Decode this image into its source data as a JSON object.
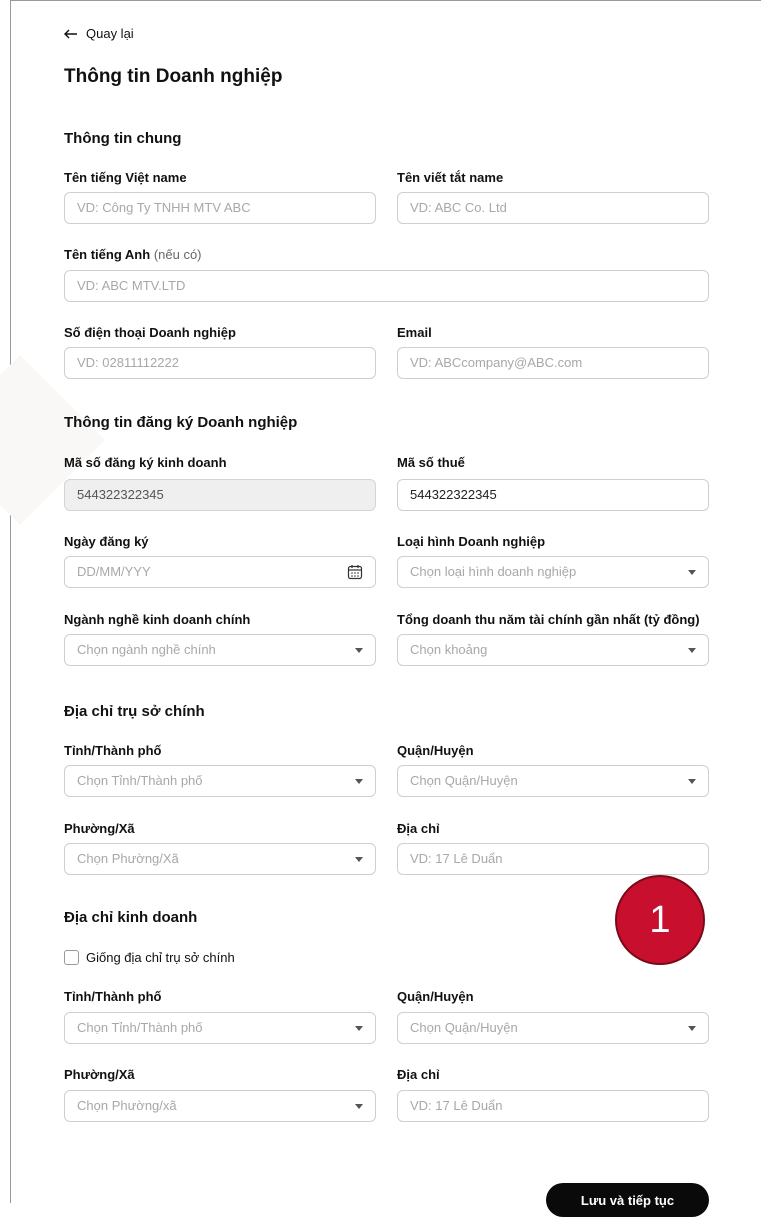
{
  "back": {
    "label": "Quay lại"
  },
  "page_title": "Thông tin Doanh nghiệp",
  "sections": {
    "general": "Thông tin chung",
    "registration": "Thông tin đăng ký Doanh nghiệp",
    "head_office": "Địa chỉ trụ sở chính",
    "business_address": "Địa chỉ kinh doanh"
  },
  "fields": {
    "vn_name": {
      "label": "Tên tiếng Việt name",
      "placeholder": "VD: Công Ty TNHH MTV ABC"
    },
    "short_name": {
      "label": "Tên viết tắt name",
      "placeholder": "VD: ABC Co. Ltd"
    },
    "en_name": {
      "label": "Tên tiếng Anh",
      "optional": "(nếu có)",
      "placeholder": "VD: ABC MTV.LTD"
    },
    "phone": {
      "label": "Số điện thoại Doanh nghiệp",
      "placeholder": "VD: 02811112222"
    },
    "email": {
      "label": "Email",
      "placeholder": "VD: ABCcompany@ABC.com"
    },
    "reg_no": {
      "label": "Mã số đăng ký kinh doanh",
      "value": "544322322345"
    },
    "tax_no": {
      "label": "Mã số thuế",
      "value": "544322322345"
    },
    "reg_date": {
      "label": "Ngày đăng ký",
      "placeholder": "DD/MM/YYY"
    },
    "biz_type": {
      "label": "Loại hình Doanh nghiệp",
      "placeholder": "Chọn loại hình doanh nghiệp"
    },
    "industry": {
      "label": "Ngành nghề kinh doanh chính",
      "placeholder": "Chọn ngành nghề chính"
    },
    "revenue": {
      "label": "Tổng doanh thu năm tài chính gần nhất (tỷ đồng)",
      "placeholder": "Chọn khoảng"
    },
    "ho_province": {
      "label": "Tỉnh/Thành phố",
      "placeholder": "Chọn Tỉnh/Thành phố"
    },
    "ho_district": {
      "label": "Quận/Huyện",
      "placeholder": "Chọn Quận/Huyện"
    },
    "ho_ward": {
      "label": "Phường/Xã",
      "placeholder": "Chọn Phường/Xã"
    },
    "ho_address": {
      "label": "Địa chỉ",
      "placeholder": "VD: 17 Lê Duẩn"
    },
    "ba_province": {
      "label": "Tỉnh/Thành phố",
      "placeholder": "Chọn Tỉnh/Thành phố"
    },
    "ba_district": {
      "label": "Quận/Huyện",
      "placeholder": "Chọn Quận/Huyện"
    },
    "ba_ward": {
      "label": "Phường/Xã",
      "placeholder": "Chọn Phường/xã"
    },
    "ba_address": {
      "label": "Địa chỉ",
      "placeholder": "VD: 17 Lê Duẩn"
    }
  },
  "same_address_checkbox": {
    "label": "Giống địa chỉ trụ sở chính",
    "checked": false
  },
  "step_badge": "1",
  "save_button": "Lưu và tiếp tục",
  "colors": {
    "badge": "#c8102e",
    "button": "#0a0a0a",
    "border": "#cfcfcf"
  }
}
